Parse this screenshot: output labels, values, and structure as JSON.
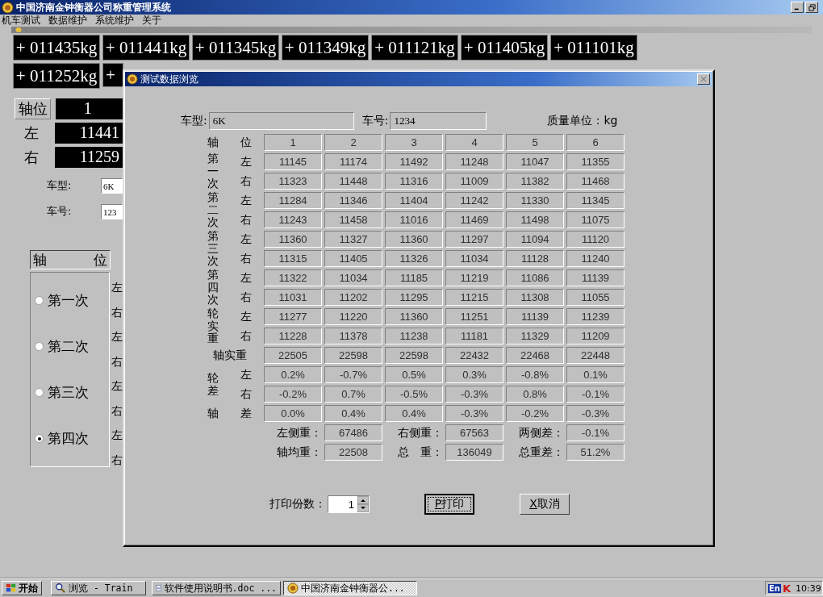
{
  "app_window": {
    "title": "中国济南金钟衡器公司称重管理系统"
  },
  "menu": [
    "机车测试",
    "数据维护",
    "系统维护",
    "关于"
  ],
  "weight_displays": [
    [
      "+ 011435kg",
      "+ 011441kg",
      "+ 011345kg",
      "+ 011349kg",
      "+ 011121kg",
      "+ 011405kg",
      "+ 011101kg"
    ],
    [
      "+ 011252kg",
      "+"
    ]
  ],
  "axle_panel": {
    "axle_label": "轴位",
    "axle_value": "1",
    "left_label": "左",
    "left_value": "11441",
    "right_label": "右",
    "right_value": "11259",
    "model_label": "车型:",
    "model_value": "6K",
    "number_label": "车号:",
    "number_value": "123",
    "group_header": [
      "轴",
      "位"
    ],
    "runs": [
      {
        "label": "第一次",
        "selected": false
      },
      {
        "label": "第二次",
        "selected": false
      },
      {
        "label": "第三次",
        "selected": false
      },
      {
        "label": "第四次",
        "selected": true
      }
    ],
    "side_labels": [
      "左",
      "右",
      "左",
      "右",
      "左",
      "右",
      "左",
      "右"
    ]
  },
  "dialog": {
    "title": "测试数据浏览",
    "model_label": "车型:",
    "model_value": "6K",
    "number_label": "车号:",
    "number_value": "1234",
    "unit": "质量单位：kg",
    "table": {
      "header": {
        "label": "轴",
        "side": "位",
        "axles": [
          "1",
          "2",
          "3",
          "4",
          "5",
          "6"
        ]
      },
      "groups": [
        {
          "kind": "pair",
          "label": "第一次",
          "rows": [
            {
              "side": "左",
              "values": [
                "11145",
                "11174",
                "11492",
                "11248",
                "11047",
                "11355"
              ]
            },
            {
              "side": "右",
              "values": [
                "11323",
                "11448",
                "11316",
                "11009",
                "11382",
                "11468"
              ]
            }
          ]
        },
        {
          "kind": "pair",
          "label": "第二次",
          "rows": [
            {
              "side": "左",
              "values": [
                "11284",
                "11346",
                "11404",
                "11242",
                "11330",
                "11345"
              ]
            },
            {
              "side": "右",
              "values": [
                "11243",
                "11458",
                "11016",
                "11469",
                "11498",
                "11075"
              ]
            }
          ]
        },
        {
          "kind": "pair",
          "label": "第三次",
          "rows": [
            {
              "side": "左",
              "values": [
                "11360",
                "11327",
                "11360",
                "11297",
                "11094",
                "11120"
              ]
            },
            {
              "side": "右",
              "values": [
                "11315",
                "11405",
                "11326",
                "11034",
                "11128",
                "11240"
              ]
            }
          ]
        },
        {
          "kind": "pair",
          "label": "第四次",
          "rows": [
            {
              "side": "左",
              "values": [
                "11322",
                "11034",
                "11185",
                "11219",
                "11086",
                "11139"
              ]
            },
            {
              "side": "右",
              "values": [
                "11031",
                "11202",
                "11295",
                "11215",
                "11308",
                "11055"
              ]
            }
          ]
        },
        {
          "kind": "pair",
          "label": "轮实重",
          "rows": [
            {
              "side": "左",
              "values": [
                "11277",
                "11220",
                "11360",
                "11251",
                "11139",
                "11239"
              ]
            },
            {
              "side": "右",
              "values": [
                "11228",
                "11378",
                "11238",
                "11181",
                "11329",
                "11209"
              ]
            }
          ]
        },
        {
          "kind": "wide",
          "label": "轴实重",
          "rows": [
            {
              "values": [
                "22505",
                "22598",
                "22598",
                "22432",
                "22468",
                "22448"
              ]
            }
          ]
        },
        {
          "kind": "pair",
          "label": "轮差",
          "rows": [
            {
              "side": "左",
              "values": [
                "0.2%",
                "-0.7%",
                "0.5%",
                "0.3%",
                "-0.8%",
                "0.1%"
              ]
            },
            {
              "side": "右",
              "values": [
                "-0.2%",
                "0.7%",
                "-0.5%",
                "-0.3%",
                "0.8%",
                "-0.1%"
              ]
            }
          ]
        },
        {
          "kind": "pair",
          "label": "轴",
          "rows": [
            {
              "side": "差",
              "values": [
                "0.0%",
                "0.4%",
                "0.4%",
                "-0.3%",
                "-0.2%",
                "-0.3%"
              ]
            }
          ]
        }
      ]
    },
    "summary": [
      [
        {
          "label": "左侧重：",
          "value": "67486"
        },
        {
          "label": "右侧重：",
          "value": "67563"
        },
        {
          "label": "两侧差：",
          "value": "-0.1%"
        }
      ],
      [
        {
          "label": "轴均重：",
          "value": "22508"
        },
        {
          "label": "总　重：",
          "value": "136049"
        },
        {
          "label": "总重差：",
          "value": "51.2%"
        }
      ]
    ],
    "copies_label": "打印份数：",
    "copies_value": "1",
    "buttons": [
      {
        "mnemonic": "P",
        "label": "打印",
        "focused": true
      },
      {
        "mnemonic": "X",
        "label": "取消",
        "focused": false
      }
    ]
  },
  "taskbar": {
    "start": "开始",
    "tasks": [
      {
        "kind": "search",
        "label": "浏览 - Train",
        "selected": false
      },
      {
        "kind": "doc",
        "label": "软件使用说明书.doc ...",
        "selected": false
      },
      {
        "kind": "app",
        "label": "中国济南金钟衡器公...",
        "selected": true
      }
    ],
    "tray": {
      "language": "En",
      "ime": "K",
      "clock": "10:39"
    }
  }
}
